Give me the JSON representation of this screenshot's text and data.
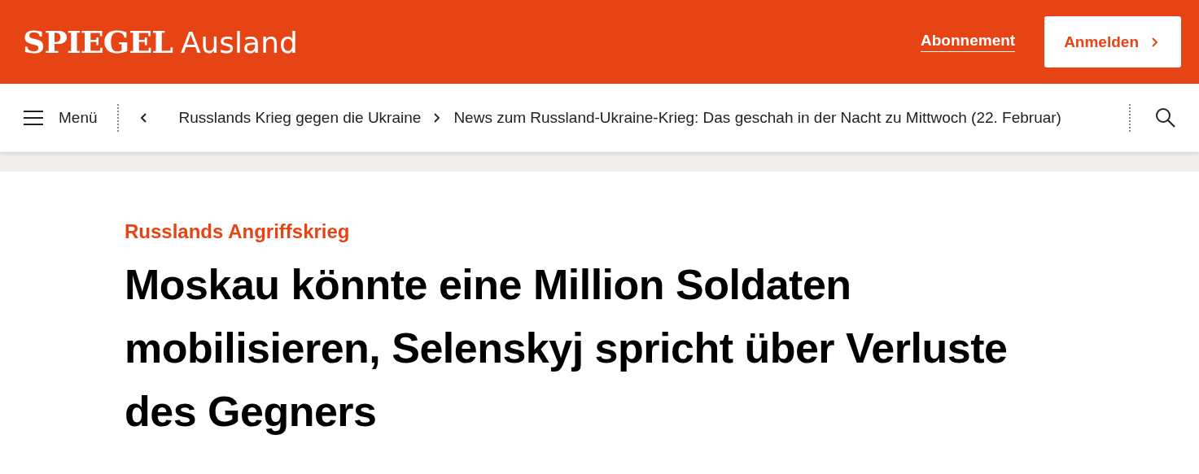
{
  "header": {
    "logo": "SPIEGEL",
    "section": "Ausland",
    "subscription_link": "Abonnement",
    "login_button": "Anmelden"
  },
  "nav": {
    "menu_label": "Menü",
    "breadcrumbs": [
      "Russlands Krieg gegen die Ukraine",
      "News zum Russland-Ukraine-Krieg: Das geschah in der Nacht zu Mittwoch (22. Februar)"
    ]
  },
  "article": {
    "kicker": "Russlands Angriffskrieg",
    "headline": "Moskau könnte eine Million Soldaten mobilisieren, Selenskyj spricht über Verluste des Gegners"
  }
}
